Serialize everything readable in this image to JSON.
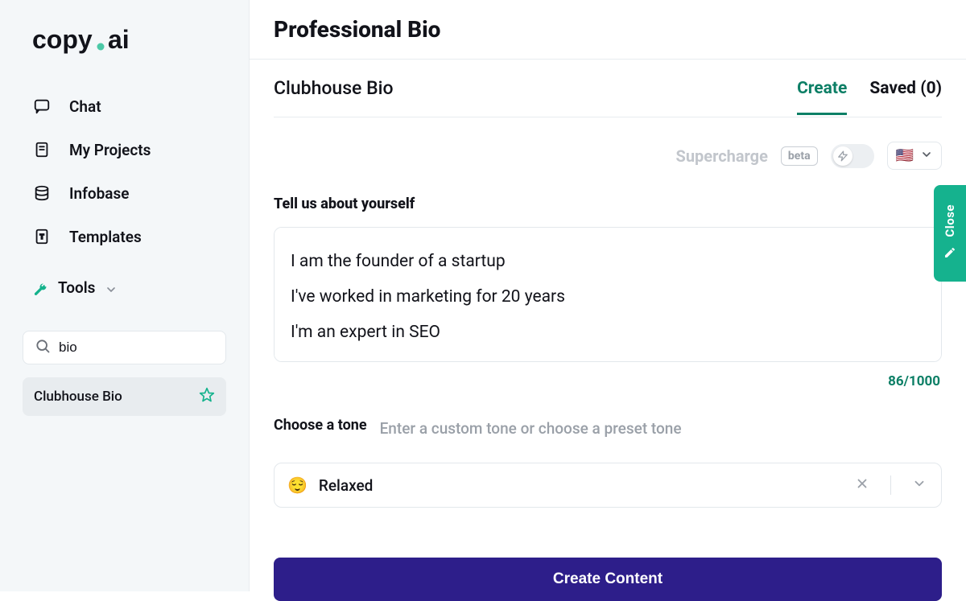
{
  "logo": {
    "text1": "copy",
    "dot": ".",
    "text2": "ai"
  },
  "sidebar": {
    "items": [
      {
        "label": "Chat"
      },
      {
        "label": "My Projects"
      },
      {
        "label": "Infobase"
      },
      {
        "label": "Templates"
      }
    ],
    "tools_label": "Tools",
    "search_value": "bio",
    "result_label": "Clubhouse Bio"
  },
  "page": {
    "title": "Professional Bio",
    "breadcrumb": "Clubhouse Bio",
    "tabs": {
      "create": "Create",
      "saved": "Saved (0)"
    },
    "supercharge": "Supercharge",
    "beta": "beta",
    "language_flag": "🇺🇸"
  },
  "form": {
    "about_label": "Tell us about yourself",
    "about_value": "I am the founder of a startup\nI've worked in marketing for 20 years\nI'm an expert in SEO",
    "char_counter": "86/1000",
    "tone_label": "Choose a tone",
    "tone_hint": "Enter a custom tone or choose a preset tone",
    "tone_emoji": "😌",
    "tone_name": "Relaxed",
    "create_button": "Create Content"
  },
  "close_tab": "Close"
}
